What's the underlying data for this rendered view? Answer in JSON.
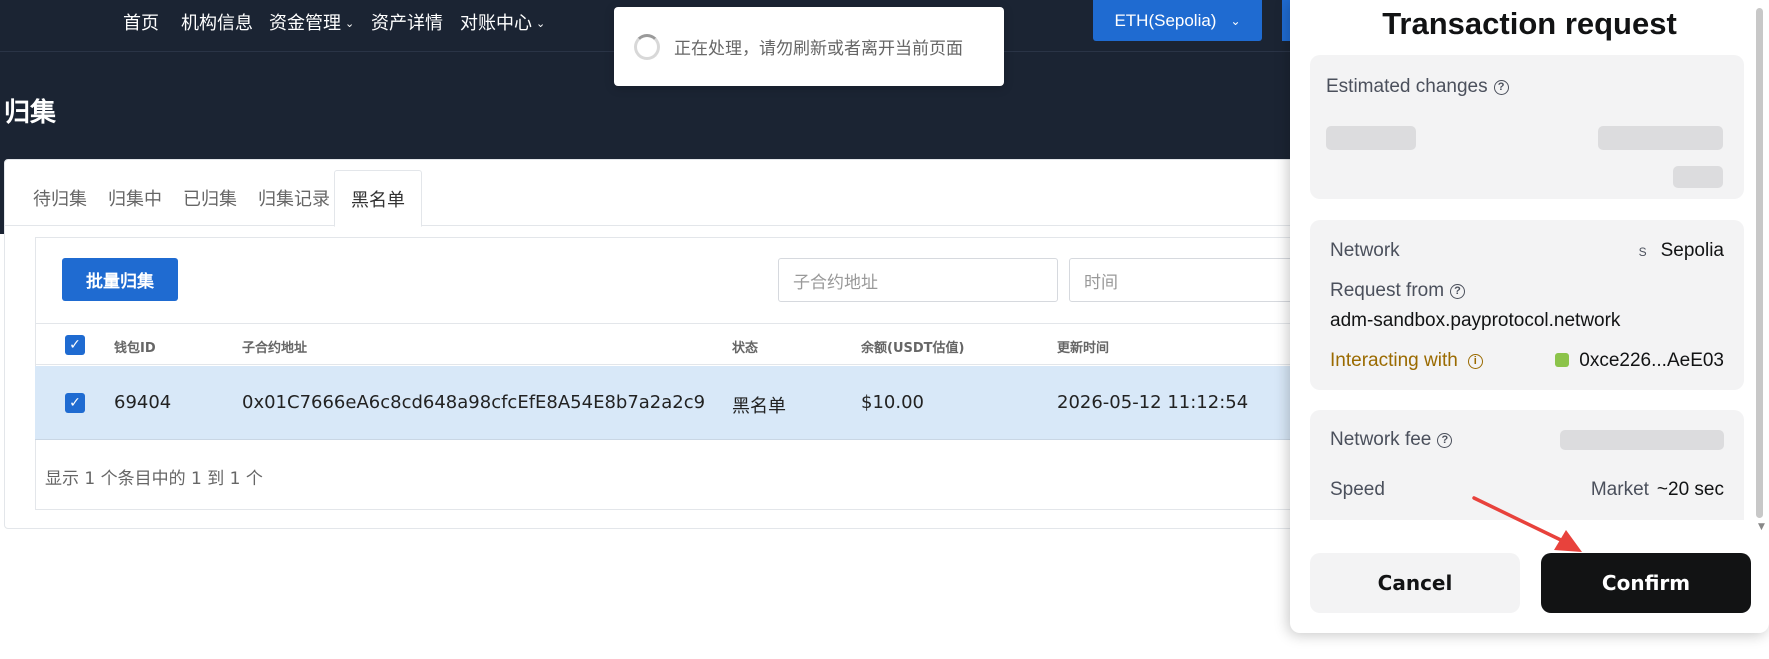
{
  "nav": {
    "items": [
      {
        "label": "首页",
        "has_dropdown": false
      },
      {
        "label": "机构信息",
        "has_dropdown": false
      },
      {
        "label": "资金管理",
        "has_dropdown": true
      },
      {
        "label": "资产详情",
        "has_dropdown": false
      },
      {
        "label": "对账中心",
        "has_dropdown": true
      }
    ],
    "network_button": "ETH(Sepolia)"
  },
  "toast": {
    "text": "正在处理，请勿刷新或者离开当前页面"
  },
  "page": {
    "title": "归集",
    "tabs": [
      "待归集",
      "归集中",
      "已归集",
      "归集记录",
      "黑名单"
    ],
    "active_tab": "黑名单",
    "bulk_button": "批量归集",
    "filters": {
      "address_placeholder": "子合约地址",
      "time_placeholder": "时间"
    },
    "table": {
      "headers": [
        "钱包ID",
        "子合约地址",
        "状态",
        "余额(USDT估值)",
        "更新时间"
      ],
      "rows": [
        {
          "wallet_id": "69404",
          "address": "0x01C7666eA6c8cd648a98cfcEfE8A54E8b7a2a2c9",
          "status": "黑名单",
          "balance": "$10.00",
          "updated": "2026-05-12 11:12:54",
          "checked": true
        }
      ]
    },
    "pagination_info": "显示 1 个条目中的 1 到 1 个"
  },
  "transaction": {
    "title": "Transaction request",
    "estimated_changes_label": "Estimated changes",
    "network_label": "Network",
    "network_icon_letter": "S",
    "network_value": "Sepolia",
    "request_from_label": "Request from",
    "request_from_value": "adm-sandbox.payprotocol.network",
    "interacting_label": "Interacting with",
    "interacting_value": "0xce226...AeE03",
    "network_fee_label": "Network fee",
    "speed_label": "Speed",
    "speed_mode": "Market",
    "speed_value": "~20 sec",
    "cancel_label": "Cancel",
    "confirm_label": "Confirm",
    "accent_color": "#9a6a00"
  }
}
